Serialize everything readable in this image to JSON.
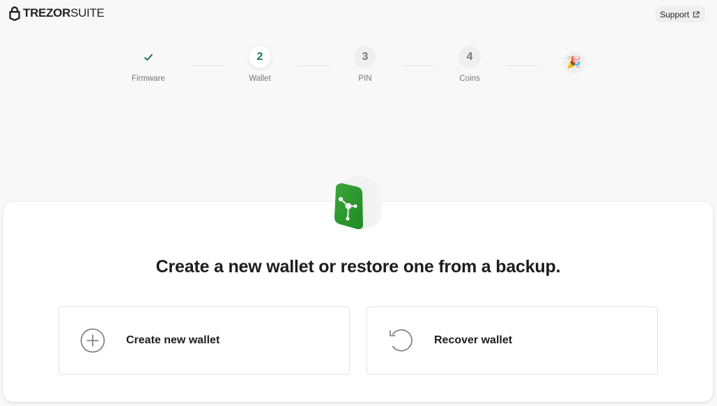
{
  "header": {
    "logo_bold": "TREZOR",
    "logo_light": "SUITE",
    "support_label": "Support"
  },
  "stepper": {
    "steps": [
      {
        "number": "✓",
        "label": "Firmware",
        "state": "done"
      },
      {
        "number": "2",
        "label": "Wallet",
        "state": "active"
      },
      {
        "number": "3",
        "label": "PIN",
        "state": "todo"
      },
      {
        "number": "4",
        "label": "Coins",
        "state": "todo"
      }
    ],
    "final_icon": "🎉"
  },
  "main": {
    "headline": "Create a new wallet or restore one from a backup.",
    "options": [
      {
        "label": "Create new wallet",
        "icon": "plus-circle-icon"
      },
      {
        "label": "Recover wallet",
        "icon": "recover-arrow-icon"
      }
    ]
  },
  "colors": {
    "accent": "#1b7a4a",
    "background": "#f8f8f8",
    "card": "#ffffff"
  }
}
